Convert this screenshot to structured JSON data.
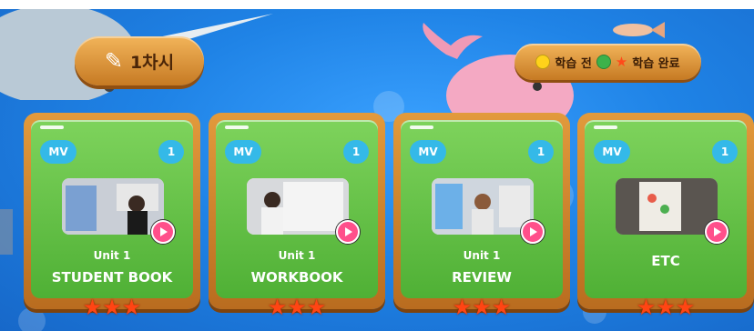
{
  "session": {
    "label": "1차시",
    "icon": "pencil-icon"
  },
  "legend": {
    "before_label": "학습 전",
    "done_label": "학습 완료"
  },
  "colors": {
    "card_frame": "#c67a23",
    "card_inner": "#5fbf3f",
    "badge": "#34b9e8",
    "play": "#ff4f8b",
    "star": "#ff4513"
  },
  "cards": [
    {
      "type": "MV",
      "count": "1",
      "unit": "Unit 1",
      "title": "STUDENT BOOK",
      "stars": 3
    },
    {
      "type": "MV",
      "count": "1",
      "unit": "Unit 1",
      "title": "WORKBOOK",
      "stars": 3
    },
    {
      "type": "MV",
      "count": "1",
      "unit": "Unit 1",
      "title": "REVIEW",
      "stars": 3
    },
    {
      "type": "MV",
      "count": "1",
      "unit": "",
      "title": "ETC",
      "stars": 3
    }
  ]
}
